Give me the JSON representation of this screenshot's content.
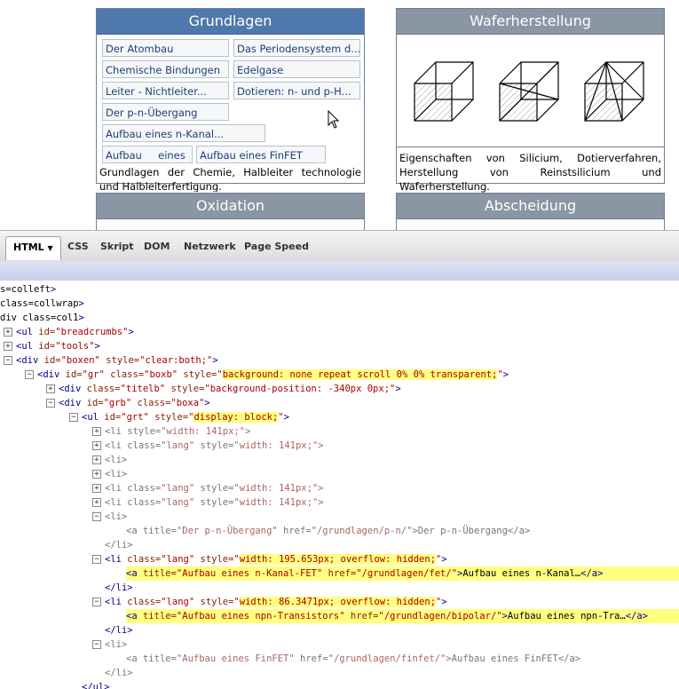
{
  "boxes": {
    "grundlagen": {
      "title": "Grundlagen",
      "links": [
        "Der Atombau",
        "Das Periodensystem d...",
        "Chemische Bindungen",
        "Edelgase",
        "Leiter - Nichtleiter...",
        "Dotieren: n- und p-H...",
        "Der p-n-Übergang",
        "Aufbau eines n-Kanal...",
        "Aufbau     eines",
        "Aufbau eines FinFET"
      ],
      "description": "Grundlagen der Chemie, Halbleiter technologie und Halbleiterfertigung."
    },
    "wafer": {
      "title": "Waferherstellung",
      "description": "Eigenschaften von Silicium, Dotierverfahren, Herstellung von Reinstsilicium und Waferherstellung."
    },
    "oxidation": {
      "title": "Oxidation"
    },
    "abscheidung": {
      "title": "Abscheidung"
    }
  },
  "firebug": {
    "tabs": [
      "HTML",
      "CSS",
      "Skript",
      "DOM",
      "Netzwerk",
      "Page Speed"
    ],
    "active_tab": "HTML",
    "lines": [
      {
        "t": "s=\"colleft\">"
      },
      {
        "t": "class=\"collwrap\">"
      },
      {
        "t": "div class=\"col1\">"
      },
      {
        "t": "<ul id=\"breadcrumbs\">"
      },
      {
        "t": "<ul id=\"tools\">"
      },
      {
        "t": "<div id=\"boxen\" style=\"clear:both;\">"
      },
      {
        "t": "<div id=\"gr\" class=\"boxb\" style=\"background: none repeat scroll 0% 0% transparent;\">"
      },
      {
        "t": "<div class=\"titelb\" style=\"background-position: -340px 0px;\">"
      },
      {
        "t": "<div id=\"grb\" class=\"boxa\">"
      },
      {
        "t": "<ul id=\"grt\" style=\"display: block;\">"
      },
      {
        "t": "<li style=\"width: 141px;\">"
      },
      {
        "t": "<li class=\"lang\" style=\"width: 141px;\">"
      },
      {
        "t": "<li>"
      },
      {
        "t": "<li>"
      },
      {
        "t": "<li class=\"lang\" style=\"width: 141px;\">"
      },
      {
        "t": "<li class=\"lang\" style=\"width: 141px;\">"
      },
      {
        "t": "<li>"
      },
      {
        "t": "<a title=\"Der p-n-Übergang\" href=\"/grundlagen/p-n/\">Der p-n-Übergang</a>"
      },
      {
        "t": "</li>"
      },
      {
        "t": "<li class=\"lang\" style=\"width: 195.653px; overflow: hidden;\">"
      },
      {
        "t": "<a title=\"Aufbau eines n-Kanal-FET\" href=\"/grundlagen/fet/\">Aufbau eines n-Kanal…</a>"
      },
      {
        "t": "</li>"
      },
      {
        "t": "<li class=\"lang\" style=\"width: 86.3471px; overflow: hidden;\">"
      },
      {
        "t": "<a title=\"Aufbau eines npn-Transistors\" href=\"/grundlagen/bipolar/\">Aufbau eines npn-Tra…</a>"
      },
      {
        "t": "</li>"
      },
      {
        "t": "<li>"
      },
      {
        "t": "<a title=\"Aufbau eines FinFET\" href=\"/grundlagen/finfet/\">Aufbau eines FinFET</a>"
      },
      {
        "t": "</li>"
      },
      {
        "t": "</ul>"
      }
    ]
  }
}
